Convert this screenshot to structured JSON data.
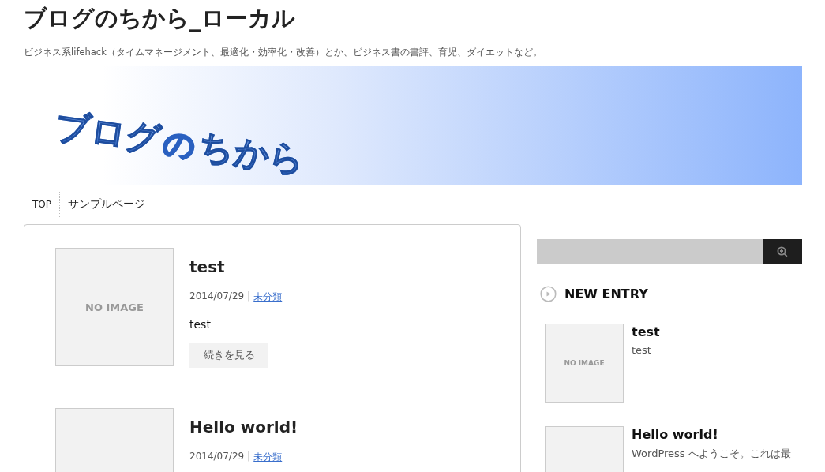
{
  "site": {
    "title": "ブログのちから_ローカル",
    "tagline": "ビジネス系lifehack（タイムマネージメント、最適化・効率化・改善）とか、ビジネス書の書評、育児、ダイエットなど。"
  },
  "banner": {
    "logo_parts": [
      "ブログ",
      "の",
      "ちから"
    ]
  },
  "nav": [
    {
      "label": "TOP"
    },
    {
      "label": "サンプルページ"
    }
  ],
  "posts": [
    {
      "thumbnail": "NO IMAGE",
      "title": "test",
      "date": "2014/07/29",
      "separator": "|",
      "category": "未分類",
      "excerpt": "test",
      "more_button": "続きを見る"
    },
    {
      "title": "Hello world!",
      "date": "2014/07/29",
      "separator": "|",
      "category": "未分類"
    }
  ],
  "sidebar": {
    "new_entry": {
      "heading": "NEW ENTRY",
      "items": [
        {
          "thumbnail": "NO IMAGE",
          "title": "test",
          "excerpt": "test"
        },
        {
          "title": "Hello world!",
          "excerpt": "WordPress へようこそ。これは最"
        }
      ]
    }
  }
}
